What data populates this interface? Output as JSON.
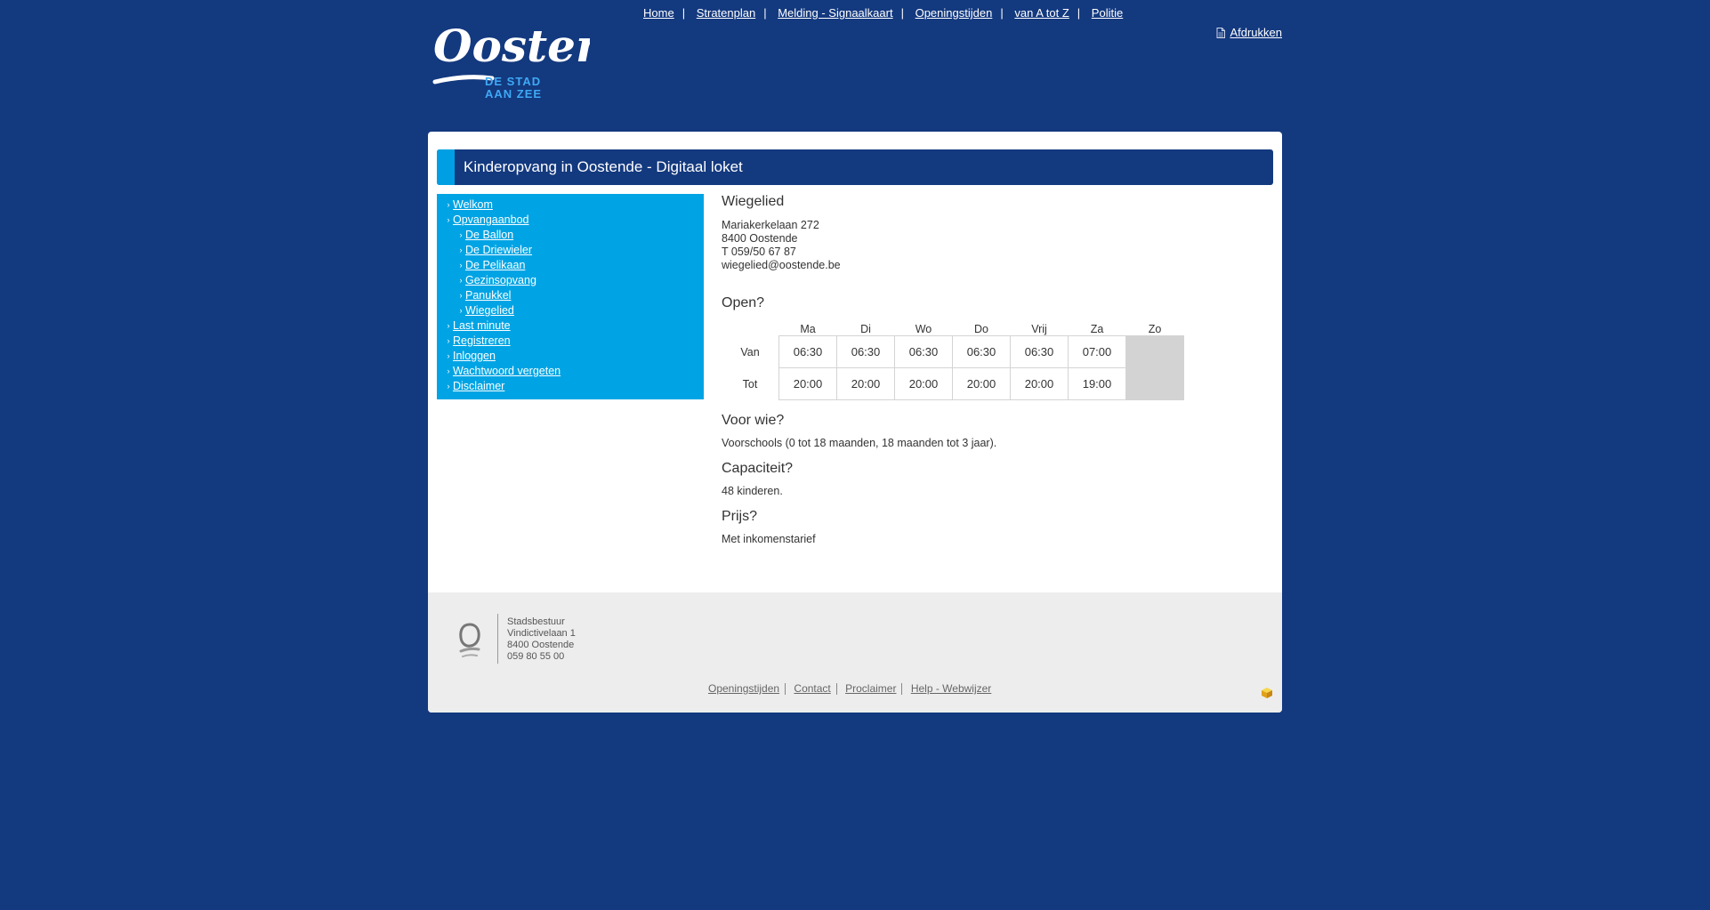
{
  "header": {
    "logo": {
      "wordmark": "Oostende",
      "tagline_1": "DE STAD",
      "tagline_2": "AAN ZEE"
    },
    "topnav": [
      "Home",
      "Stratenplan",
      "Melding - Signaalkaart",
      "Openingstijden",
      "van A tot Z",
      "Politie"
    ],
    "print_label": "Afdrukken"
  },
  "page_title": "Kinderopvang in Oostende - Digitaal loket",
  "sidebar": {
    "items": [
      {
        "label": "Welkom",
        "level": 1
      },
      {
        "label": "Opvangaanbod",
        "level": 1
      },
      {
        "label": "De Ballon",
        "level": 2
      },
      {
        "label": "De Driewieler",
        "level": 2
      },
      {
        "label": "De Pelikaan",
        "level": 2
      },
      {
        "label": "Gezinsopvang",
        "level": 2
      },
      {
        "label": "Panukkel",
        "level": 2
      },
      {
        "label": "Wiegelied",
        "level": 2
      },
      {
        "label": "Last minute",
        "level": 1
      },
      {
        "label": "Registreren",
        "level": 1
      },
      {
        "label": "Inloggen",
        "level": 1
      },
      {
        "label": "Wachtwoord vergeten",
        "level": 1
      },
      {
        "label": "Disclaimer",
        "level": 1
      }
    ]
  },
  "content": {
    "title": "Wiegelied",
    "address": [
      "Mariakerkelaan 272",
      "8400 Oostende",
      "T 059/50 67 87",
      "wiegelied@oostende.be"
    ],
    "open_heading": "Open?",
    "hours": {
      "days": [
        "Ma",
        "Di",
        "Wo",
        "Do",
        "Vrij",
        "Za",
        "Zo"
      ],
      "rows": [
        {
          "label": "Van",
          "values": [
            "06:30",
            "06:30",
            "06:30",
            "06:30",
            "06:30",
            "07:00",
            ""
          ]
        },
        {
          "label": "Tot",
          "values": [
            "20:00",
            "20:00",
            "20:00",
            "20:00",
            "20:00",
            "19:00",
            ""
          ]
        }
      ]
    },
    "voor_wie_heading": "Voor wie?",
    "voor_wie_text": "Voorschools (0 tot 18 maanden, 18 maanden tot 3 jaar).",
    "capaciteit_heading": "Capaciteit?",
    "capaciteit_text": "48 kinderen.",
    "prijs_heading": "Prijs?",
    "prijs_text": "Met inkomenstarief"
  },
  "footer": {
    "address": [
      "Stadsbestuur",
      "Vindictivelaan 1",
      "8400 Oostende",
      "059 80 55 00"
    ],
    "links": [
      "Openingstijden",
      "Contact",
      "Proclaimer",
      "Help - Webwijzer"
    ]
  },
  "colors": {
    "page_bg": "#13397f",
    "accent_blue": "#009fe3",
    "sidebar_bg": "#00a4e4",
    "footer_bg": "#ededed",
    "closed_cell": "#d3d3d3"
  },
  "icons": [
    "print-icon",
    "oostende-footer-logo-icon",
    "chevron-right-icon",
    "cube-icon"
  ]
}
